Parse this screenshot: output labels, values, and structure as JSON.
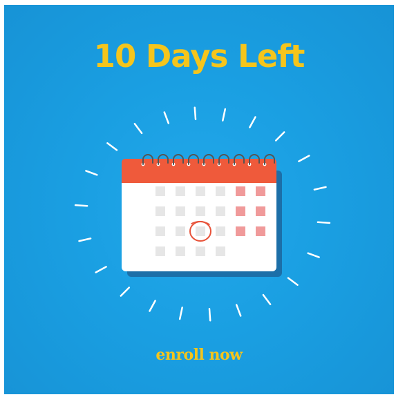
{
  "headline": "10 Days Left",
  "call_to_action": "enroll now",
  "colors": {
    "background": "#1a9fe2",
    "headline_text": "#f5c51c",
    "calendar_header": "#ef5a3b",
    "calendar_body": "#ffffff",
    "calendar_shadow": "#1c6fa8",
    "day_cell": "#e6e6e6",
    "remaining_day_cell": "#f09a9a",
    "today_circle": "#e8533a",
    "sparkle_lines": "#ffffff"
  },
  "calendar": {
    "rows": [
      [
        "past",
        "past",
        "past",
        "past",
        "remaining",
        "remaining"
      ],
      [
        "past",
        "past",
        "past",
        "past",
        "remaining",
        "remaining"
      ],
      [
        "past",
        "past",
        "today",
        "past",
        "remaining",
        "remaining"
      ],
      [
        "past",
        "past",
        "past",
        "past"
      ]
    ]
  },
  "icons": [
    "calendar-icon",
    "spiral-binding-icon",
    "sparkle-lines-icon",
    "today-circle-icon"
  ]
}
